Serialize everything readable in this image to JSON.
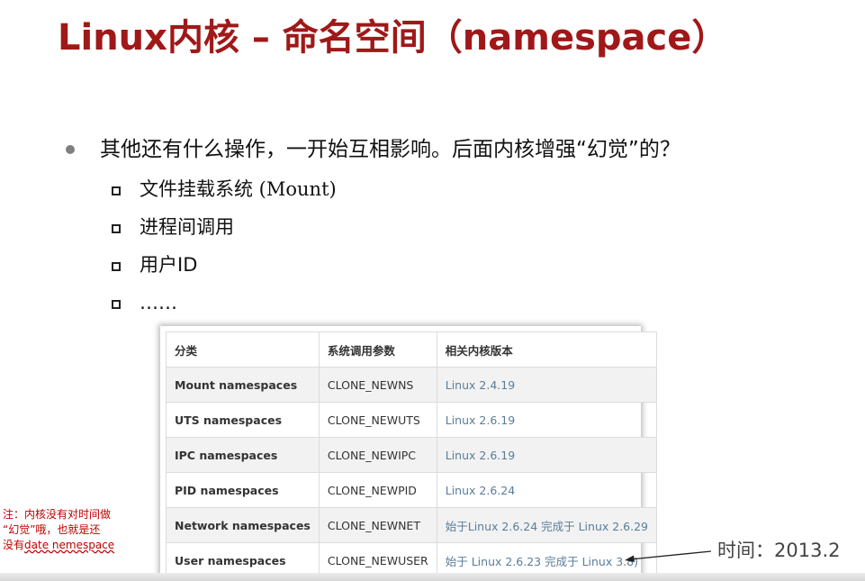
{
  "slide": {
    "title": "Linux内核 – 命名空间（namespace）",
    "main_bullet": "其他还有什么操作，一开始互相影响。后面内核增强“幻觉”的？",
    "sub_bullets": [
      {
        "text": "文件挂载系统",
        "suffix": " (Mount)"
      },
      {
        "text": "进程间调用",
        "suffix": ""
      },
      {
        "text": "用户ID",
        "suffix": ""
      },
      {
        "text": "……",
        "suffix": ""
      }
    ]
  },
  "table": {
    "headers": [
      "分类",
      "系统调用参数",
      "相关内核版本"
    ],
    "rows": [
      [
        "Mount namespaces",
        "CLONE_NEWNS",
        "Linux 2.4.19"
      ],
      [
        "UTS namespaces",
        "CLONE_NEWUTS",
        "Linux 2.6.19"
      ],
      [
        "IPC namespaces",
        "CLONE_NEWIPC",
        "Linux 2.6.19"
      ],
      [
        "PID namespaces",
        "CLONE_NEWPID",
        "Linux 2.6.24"
      ],
      [
        "Network namespaces",
        "CLONE_NEWNET",
        "始于Linux 2.6.24 完成于 Linux 2.6.29"
      ],
      [
        "User namespaces",
        "CLONE_NEWUSER",
        "始于 Linux 2.6.23 完成于 Linux 3.8)"
      ]
    ]
  },
  "note": {
    "line1": "注：内核没有对时间做",
    "line2": "“幻觉”哦，也就是还",
    "line3_prefix": "没有",
    "line3_underlined": "date nemespace"
  },
  "annotation": {
    "time_label": "时间：2013.2"
  },
  "colors": {
    "title": "#a01818",
    "note": "#c00000",
    "version_link": "#5a7d99"
  }
}
